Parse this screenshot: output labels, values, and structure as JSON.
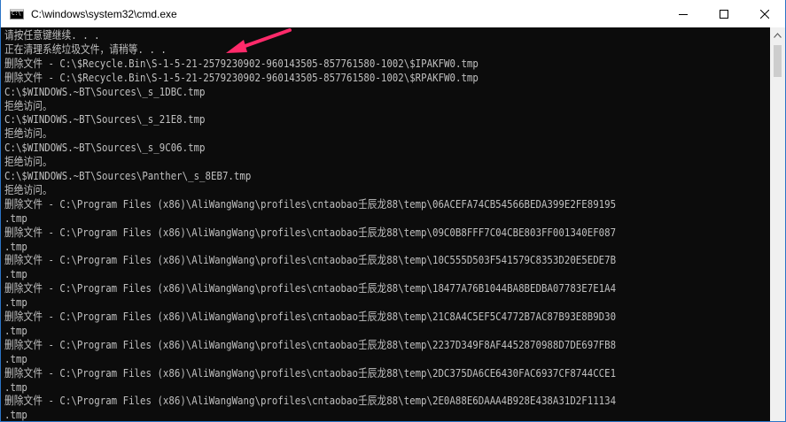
{
  "window": {
    "title": "C:\\windows\\system32\\cmd.exe",
    "icon_glyph": "C:\\"
  },
  "controls": {
    "minimize_icon": "minimize-icon",
    "maximize_icon": "maximize-icon",
    "close_icon": "close-icon"
  },
  "console": {
    "lines": [
      "请按任意键继续. . .",
      "正在清理系统垃圾文件，请稍等. . .",
      "删除文件 - C:\\$Recycle.Bin\\S-1-5-21-2579230902-960143505-857761580-1002\\$IPAKFW0.tmp",
      "删除文件 - C:\\$Recycle.Bin\\S-1-5-21-2579230902-960143505-857761580-1002\\$RPAKFW0.tmp",
      "C:\\$WINDOWS.~BT\\Sources\\_s_1DBC.tmp",
      "拒绝访问。",
      "C:\\$WINDOWS.~BT\\Sources\\_s_21E8.tmp",
      "拒绝访问。",
      "C:\\$WINDOWS.~BT\\Sources\\_s_9C06.tmp",
      "拒绝访问。",
      "C:\\$WINDOWS.~BT\\Sources\\Panther\\_s_8EB7.tmp",
      "拒绝访问。",
      "删除文件 - C:\\Program Files (x86)\\AliWangWang\\profiles\\cntaobao壬辰龙88\\temp\\06ACEFA74CB54566BEDA399E2FE89195",
      ".tmp",
      "删除文件 - C:\\Program Files (x86)\\AliWangWang\\profiles\\cntaobao壬辰龙88\\temp\\09C0B8FFF7C04CBE803FF001340EF087",
      ".tmp",
      "删除文件 - C:\\Program Files (x86)\\AliWangWang\\profiles\\cntaobao壬辰龙88\\temp\\10C555D503F541579C8353D20E5EDE7B",
      ".tmp",
      "删除文件 - C:\\Program Files (x86)\\AliWangWang\\profiles\\cntaobao壬辰龙88\\temp\\18477A76B1044BA8BEDBA07783E7E1A4",
      ".tmp",
      "删除文件 - C:\\Program Files (x86)\\AliWangWang\\profiles\\cntaobao壬辰龙88\\temp\\21C8A4C5EF5C4772B7AC87B93E8B9D30",
      ".tmp",
      "删除文件 - C:\\Program Files (x86)\\AliWangWang\\profiles\\cntaobao壬辰龙88\\temp\\2237D349F8AF4452870988D7DE697FB8",
      ".tmp",
      "删除文件 - C:\\Program Files (x86)\\AliWangWang\\profiles\\cntaobao壬辰龙88\\temp\\2DC375DA6CE6430FAC6937CF8744CCE1",
      ".tmp",
      "删除文件 - C:\\Program Files (x86)\\AliWangWang\\profiles\\cntaobao壬辰龙88\\temp\\2E0A88E6DAAA4B928E438A31D2F11134",
      ".tmp"
    ]
  },
  "colors": {
    "console_bg": "#0c0c0c",
    "console_text": "#c0c0c0",
    "annotation_arrow": "#ff2a6a",
    "window_border": "#2b74c7"
  }
}
